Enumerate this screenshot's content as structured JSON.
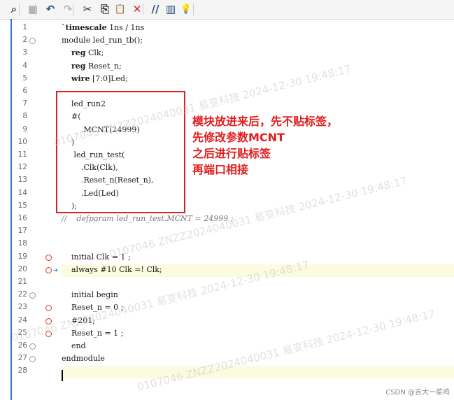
{
  "toolbar": {
    "buttons": [
      {
        "name": "search-icon",
        "glyph": "⌕",
        "color": "#4a4a4a"
      },
      {
        "name": "save-icon",
        "glyph": "■",
        "color": "#b5b5b5"
      },
      {
        "name": "undo-icon",
        "glyph": "↶",
        "color": "#2f4f7f"
      },
      {
        "name": "redo-icon",
        "glyph": "↷",
        "color": "#b5b5b5"
      },
      {
        "name": "cut-icon",
        "glyph": "✂",
        "color": "#333333"
      },
      {
        "name": "copy-icon",
        "glyph": "⎘",
        "color": "#333333"
      },
      {
        "name": "paste-icon",
        "glyph": "📋",
        "color": "#333333"
      },
      {
        "name": "delete-icon",
        "glyph": "✕",
        "color": "#d42020"
      },
      {
        "name": "comment-icon",
        "glyph": "//",
        "color": "#2f4f7f"
      },
      {
        "name": "column-select-icon",
        "glyph": "▥",
        "color": "#2f4f7f"
      },
      {
        "name": "hint-bulb-icon",
        "glyph": "💡",
        "color": "#555555"
      }
    ]
  },
  "editor": {
    "lines": [
      {
        "n": "1",
        "code": "`timescale 1ns / 1ns",
        "kw": [
          "`timescale"
        ]
      },
      {
        "n": "2",
        "code": "module led_run_tb();",
        "fold": true
      },
      {
        "n": "3",
        "code": "    reg Clk;",
        "kw": [
          "reg"
        ]
      },
      {
        "n": "4",
        "code": "    reg Reset_n;",
        "kw": [
          "reg"
        ]
      },
      {
        "n": "5",
        "code": "    wire [7:0]Led;",
        "kw": [
          "wire"
        ]
      },
      {
        "n": "6",
        "code": ""
      },
      {
        "n": "7",
        "code": "    led_run2"
      },
      {
        "n": "8",
        "code": "    #("
      },
      {
        "n": "9",
        "code": "        .MCNT(24999)"
      },
      {
        "n": "10",
        "code": "    )"
      },
      {
        "n": "11",
        "code": "     led_run_test("
      },
      {
        "n": "12",
        "code": "        .Clk(Clk),"
      },
      {
        "n": "13",
        "code": "        .Reset_n(Reset_n),"
      },
      {
        "n": "14",
        "code": "        .Led(Led)"
      },
      {
        "n": "15",
        "code": "    );"
      },
      {
        "n": "16",
        "code": "//    defparam led_run_test.MCNT = 24999 ;",
        "comment": true
      },
      {
        "n": "17",
        "code": ""
      },
      {
        "n": "18",
        "code": ""
      },
      {
        "n": "19",
        "code": "    initial Clk = 1 ;",
        "bp": true
      },
      {
        "n": "20",
        "code": "    always #10 Clk =! Clk;",
        "bp": true,
        "arrow": true,
        "current": true
      },
      {
        "n": "21",
        "code": ""
      },
      {
        "n": "22",
        "code": "    initial begin",
        "fold": true
      },
      {
        "n": "23",
        "code": "    Reset_n = 0 ;",
        "bp": true
      },
      {
        "n": "24",
        "code": "    #201;",
        "bp": true
      },
      {
        "n": "25",
        "code": "    Reset_n = 1 ;",
        "bp": true
      },
      {
        "n": "26",
        "code": "    end",
        "fold": true
      },
      {
        "n": "27",
        "code": "endmodule",
        "fold": true
      },
      {
        "n": "28",
        "code": "",
        "current": true
      }
    ]
  },
  "annotation": {
    "lines": [
      "模块放进来后，先不贴标签，",
      "先修改参数MCNT",
      "之后进行贴标签",
      "再端口相接"
    ]
  },
  "watermark": {
    "text": "0107046 ZNZZ2024040031 易变科技 2024-12-30 19:48:17"
  },
  "credit": "CSDN @吉大一菜鸡",
  "colors": {
    "annotation": "#e02020",
    "breakpoint": "#e03030",
    "current_line": "#fbfbdf"
  }
}
